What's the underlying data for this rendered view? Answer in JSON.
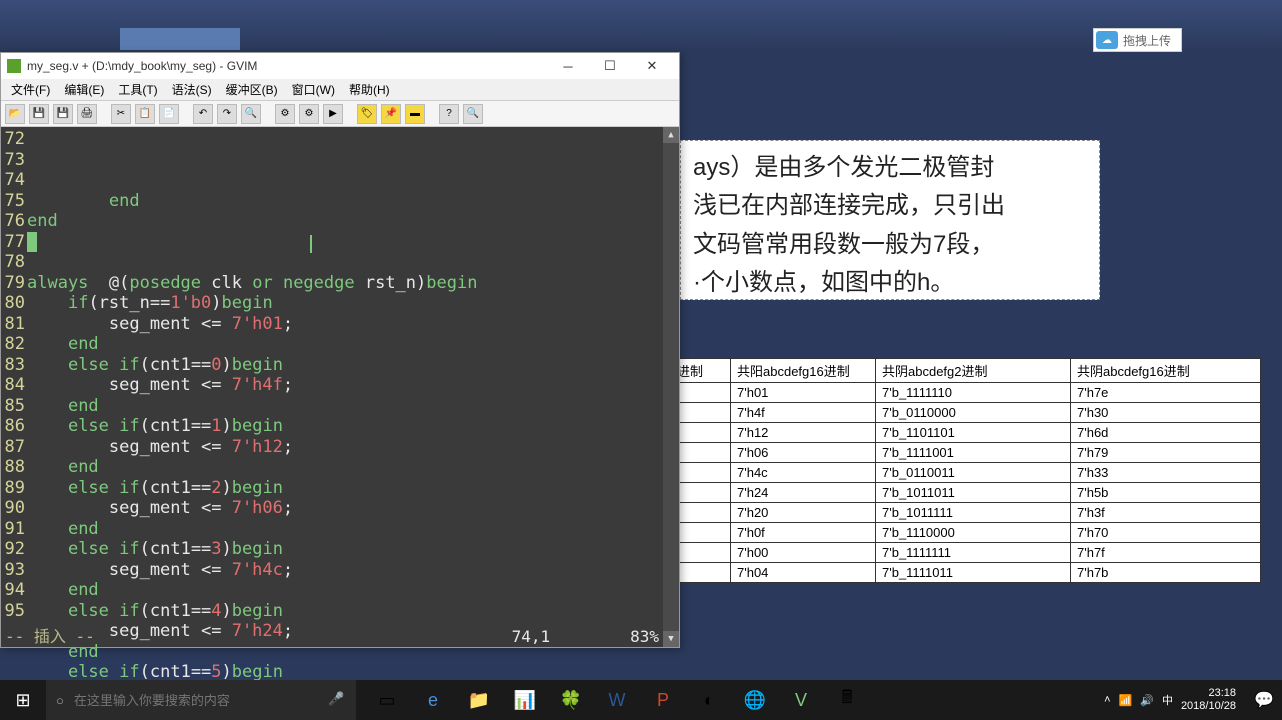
{
  "gvim": {
    "title": "my_seg.v + (D:\\mdy_book\\my_seg) - GVIM",
    "menu": [
      "文件(F)",
      "编辑(E)",
      "工具(T)",
      "语法(S)",
      "缓冲区(B)",
      "窗口(W)",
      "帮助(H)"
    ],
    "lines": [
      {
        "n": "72",
        "t": "        end"
      },
      {
        "n": "73",
        "t": "end"
      },
      {
        "n": "74",
        "t": ""
      },
      {
        "n": "75",
        "t": ""
      },
      {
        "n": "76",
        "t": "always  @(posedge clk or negedge rst_n)begin"
      },
      {
        "n": "77",
        "t": "    if(rst_n==1'b0)begin"
      },
      {
        "n": "78",
        "t": "        seg_ment <= 7'h01;"
      },
      {
        "n": "79",
        "t": "    end"
      },
      {
        "n": "80",
        "t": "    else if(cnt1==0)begin"
      },
      {
        "n": "81",
        "t": "        seg_ment <= 7'h4f;"
      },
      {
        "n": "82",
        "t": "    end"
      },
      {
        "n": "83",
        "t": "    else if(cnt1==1)begin"
      },
      {
        "n": "84",
        "t": "        seg_ment <= 7'h12;"
      },
      {
        "n": "85",
        "t": "    end"
      },
      {
        "n": "86",
        "t": "    else if(cnt1==2)begin"
      },
      {
        "n": "87",
        "t": "        seg_ment <= 7'h06;"
      },
      {
        "n": "88",
        "t": "    end"
      },
      {
        "n": "89",
        "t": "    else if(cnt1==3)begin"
      },
      {
        "n": "90",
        "t": "        seg_ment <= 7'h4c;"
      },
      {
        "n": "91",
        "t": "    end"
      },
      {
        "n": "92",
        "t": "    else if(cnt1==4)begin"
      },
      {
        "n": "93",
        "t": "        seg_ment <= 7'h24;"
      },
      {
        "n": "94",
        "t": "    end"
      },
      {
        "n": "95",
        "t": "    else if(cnt1==5)begin"
      }
    ],
    "status": {
      "mode": "-- 插入 --",
      "pos": "74,1",
      "pct": "83%"
    }
  },
  "cloud_label": "拖拽上传",
  "doc_text": "ays）是由多个发光二极管封\n浅已在内部连接完成，只引出\n文码管常用段数一般为7段，\n小数点，如图中的h。",
  "doc_text_lines": [
    "ays）是由多个发光二极管封",
    "浅已在内部连接完成，只引出",
    "文码管常用段数一般为7段，",
    "·个小数点，如图中的h。"
  ],
  "table": {
    "headers": [
      "进制",
      "共阳abcdefg16进制",
      "共阴abcdefg2进制",
      "共阴abcdefg16进制"
    ],
    "rows": [
      [
        "",
        "7'h01",
        "7'b_1111110",
        "7'h7e"
      ],
      [
        "",
        "7'h4f",
        "7'b_0110000",
        "7'h30"
      ],
      [
        "",
        "7'h12",
        "7'b_1101101",
        "7'h6d"
      ],
      [
        "",
        "7'h06",
        "7'b_1111001",
        "7'h79"
      ],
      [
        "",
        "7'h4c",
        "7'b_0110011",
        "7'h33"
      ],
      [
        "",
        "7'h24",
        "7'b_1011011",
        "7'h5b"
      ],
      [
        "",
        "7'h20",
        "7'b_1011111",
        "7'h3f"
      ],
      [
        "",
        "7'h0f",
        "7'b_1110000",
        "7'h70"
      ],
      [
        "",
        "7'h00",
        "7'b_1111111",
        "7'h7f"
      ],
      [
        "",
        "7'h04",
        "7'b_1111011",
        "7'h7b"
      ]
    ]
  },
  "taskbar": {
    "search_placeholder": "在这里输入你要搜索的内容",
    "time": "23:18",
    "date": "2018/10/28"
  }
}
